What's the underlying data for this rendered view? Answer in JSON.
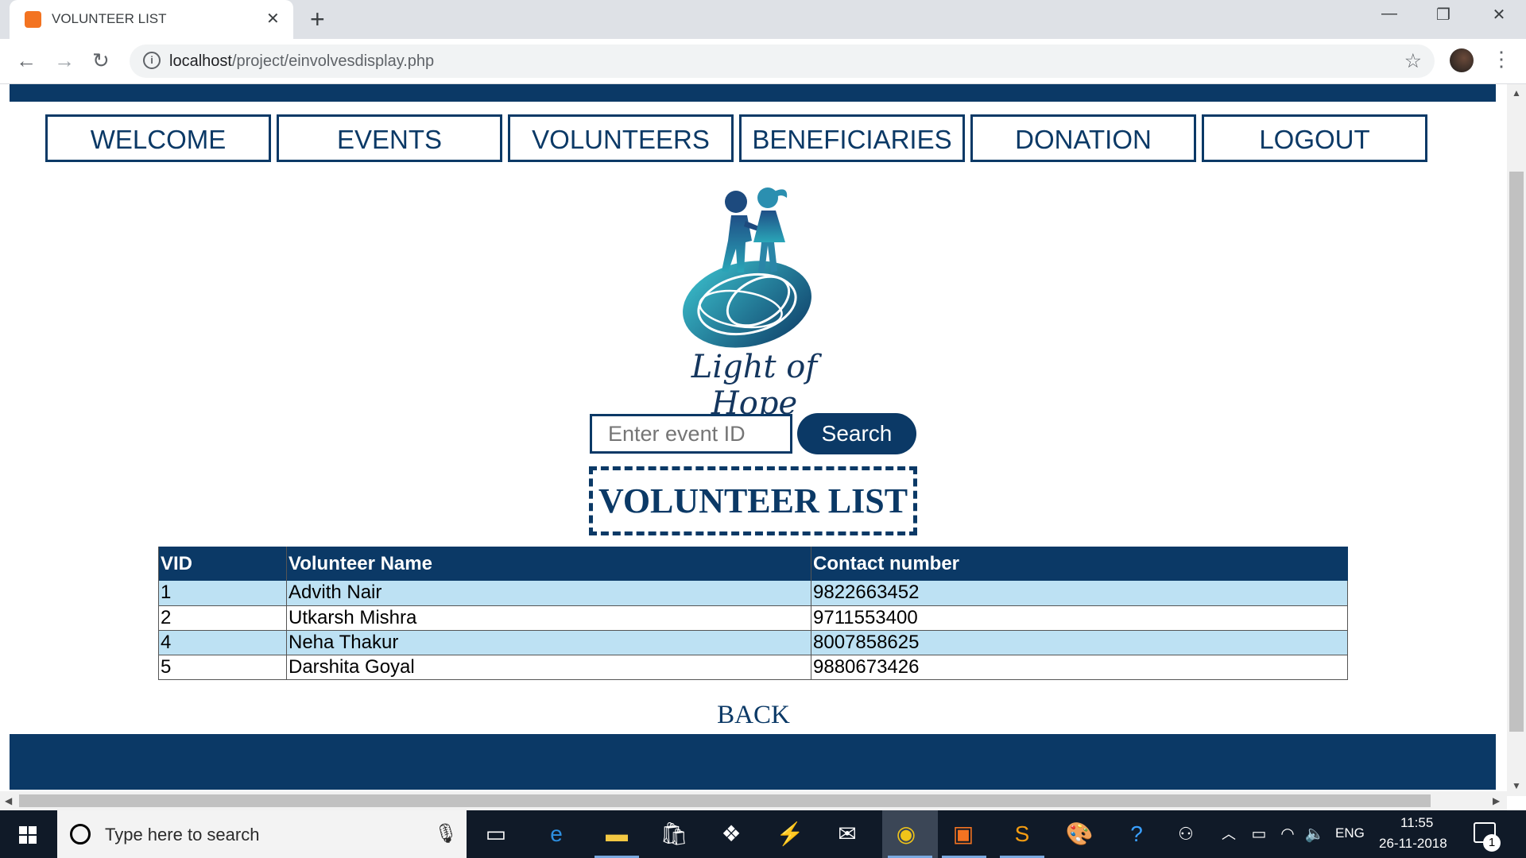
{
  "browser": {
    "tab_title": "VOLUNTEER LIST",
    "url_host": "localhost",
    "url_path": "/project/einvolvesdisplay.php"
  },
  "nav": {
    "items": [
      "WELCOME",
      "EVENTS",
      "VOLUNTEERS",
      "BENEFICIARIES",
      "DONATION",
      "LOGOUT"
    ]
  },
  "logo": {
    "text": "Light of Hope"
  },
  "search": {
    "placeholder": "Enter event ID",
    "button_label": "Search"
  },
  "list": {
    "title": "VOLUNTEER LIST",
    "columns": [
      "VID",
      "Volunteer Name",
      "Contact number"
    ],
    "rows": [
      [
        "1",
        "Advith Nair",
        "9822663452"
      ],
      [
        "2",
        "Utkarsh Mishra",
        "9711553400"
      ],
      [
        "4",
        "Neha Thakur",
        "8007858625"
      ],
      [
        "5",
        "Darshita Goyal",
        "9880673426"
      ]
    ]
  },
  "back_label": "BACK",
  "taskbar": {
    "search_placeholder": "Type here to search",
    "lang": "ENG",
    "time": "11:55",
    "date": "26-11-2018",
    "notification_count": "1"
  },
  "colors": {
    "brand": "#0b3966",
    "row_alt": "#bde1f3"
  }
}
